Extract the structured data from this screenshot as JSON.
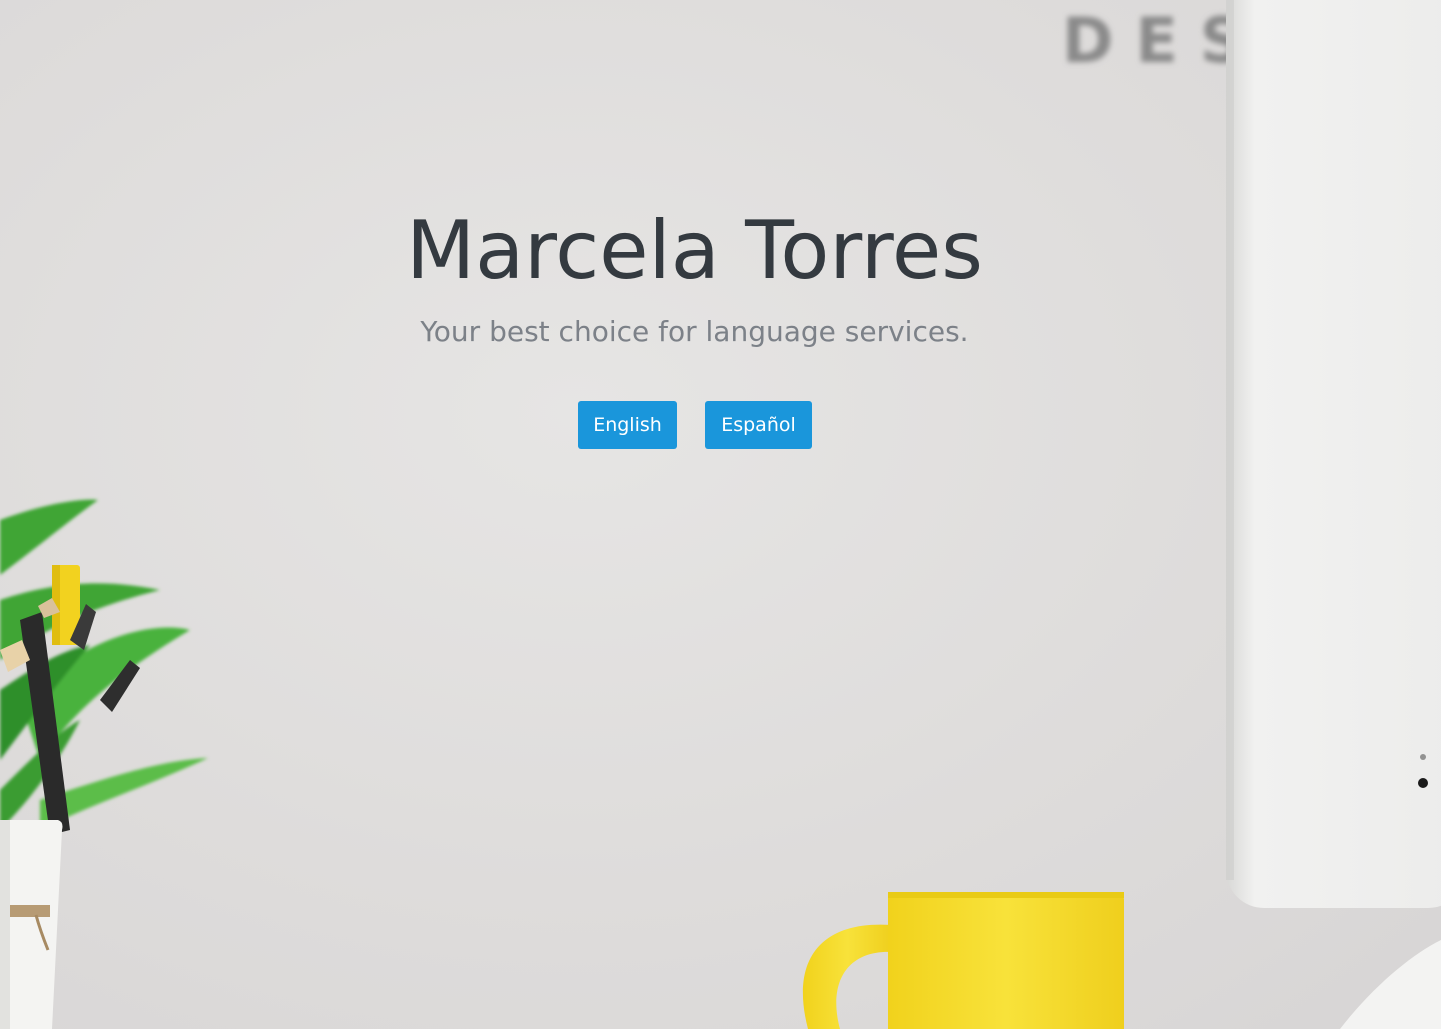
{
  "hero": {
    "title": "Marcela Torres",
    "subtitle": "Your best choice for language services."
  },
  "languages": {
    "english_label": "English",
    "spanish_label": "Español"
  },
  "colors": {
    "button": "#1a96db",
    "title_text": "#343a40",
    "subtitle_text": "#7c8188",
    "mug": "#f5dc2e"
  },
  "background": {
    "sign_letters": "DES"
  }
}
